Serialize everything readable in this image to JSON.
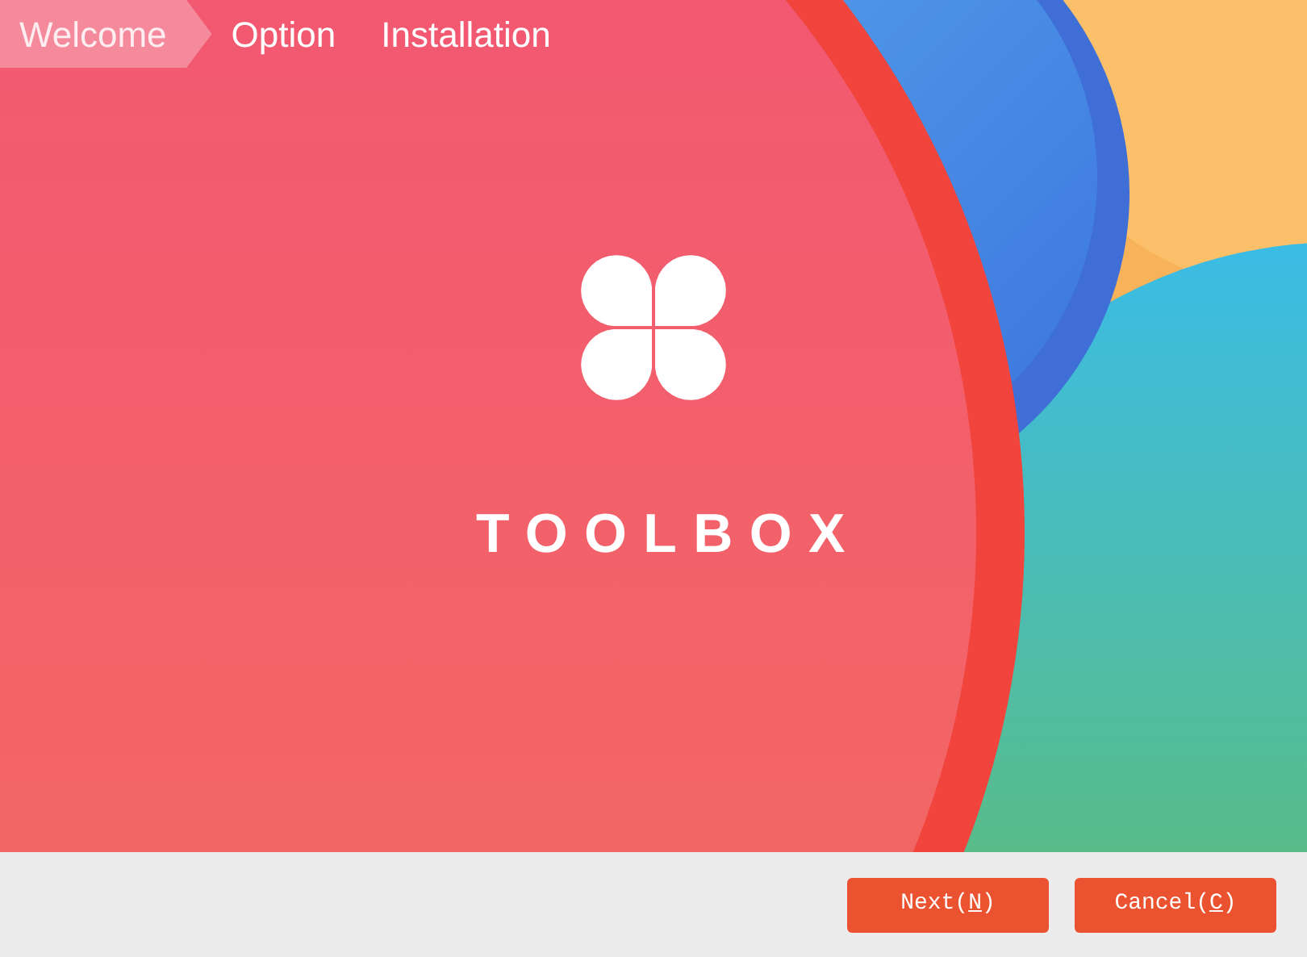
{
  "steps": [
    {
      "label": "Welcome",
      "selected": true
    },
    {
      "label": "Option",
      "selected": false
    },
    {
      "label": "Installation",
      "selected": false
    }
  ],
  "product_name": "TOOLBOX",
  "buttons": [
    {
      "text_before": "Next(",
      "mnemonic": "N",
      "text_after": ")"
    },
    {
      "text_before": "Cancel(",
      "mnemonic": "C",
      "text_after": ")"
    }
  ]
}
